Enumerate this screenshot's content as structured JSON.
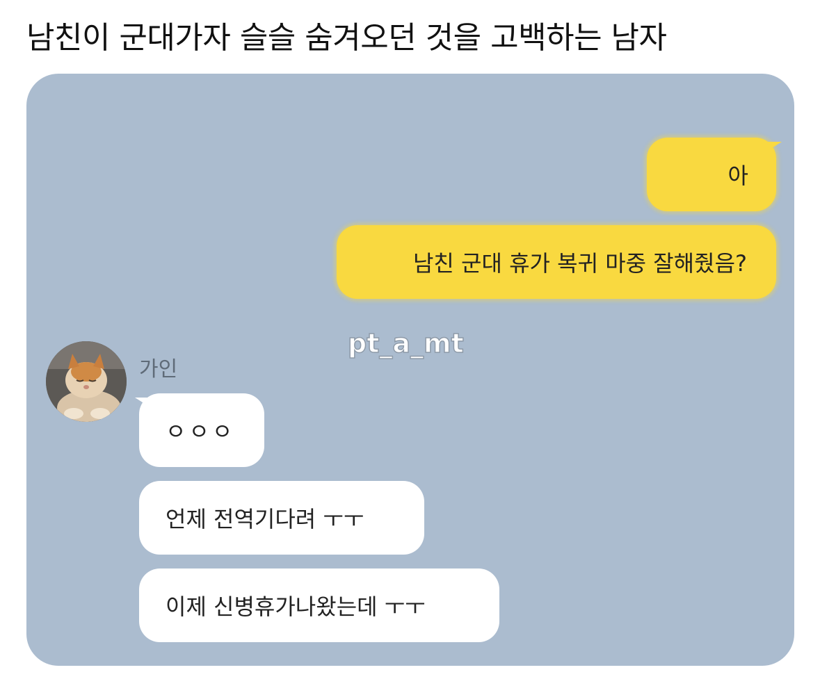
{
  "page": {
    "title": "남친이 군대가자 슬슬 숨겨오던 것을 고백하는 남자"
  },
  "watermark": "pt_a_mt",
  "chat": {
    "outgoing": [
      {
        "text": "아"
      },
      {
        "text": "남친 군대 휴가 복귀 마중 잘해줬음?"
      }
    ],
    "incoming_sender": "가인",
    "incoming": [
      {
        "text": "ㅇㅇㅇ"
      },
      {
        "text": "언제 전역기다려 ㅜㅜ"
      },
      {
        "text": "이제 신병휴가나왔는데 ㅜㅜ"
      }
    ]
  },
  "colors": {
    "chat_background": "#abbccf",
    "outgoing_bubble": "#f9d940",
    "incoming_bubble": "#ffffff"
  },
  "icons": {
    "avatar": "cat-avatar-icon"
  }
}
